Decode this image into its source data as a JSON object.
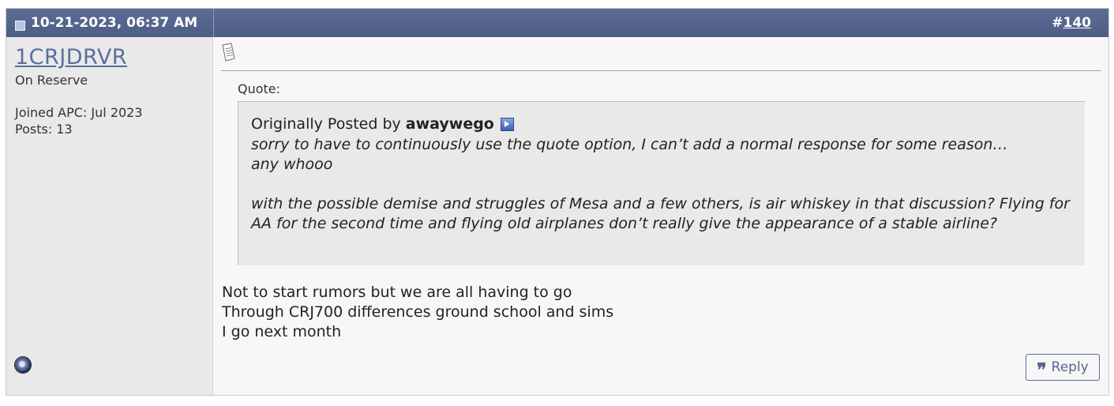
{
  "post": {
    "date": "10-21-2023, 06:37 AM",
    "number_prefix": "#",
    "number": "140"
  },
  "user": {
    "username": "1CRJDRVR",
    "title": "On Reserve",
    "joined": "Joined APC: Jul 2023",
    "posts": "Posts: 13",
    "status": "offline"
  },
  "quote": {
    "label": "Quote:",
    "originally_posted_by": "Originally Posted by",
    "author": "awaywego",
    "lines": [
      "sorry to have to continuously use the quote option, I can’t add a normal response for some reason…",
      "any whooo",
      "",
      "with the possible demise and struggles of Mesa and a few others, is air whiskey in that discussion? Flying for AA for the second time and flying old airplanes don’t really give the appearance of a stable airline?"
    ]
  },
  "message": {
    "lines": [
      "Not to start rumors but we are all having to go",
      "Through CRJ700 differences ground school and sims",
      "I go next month"
    ]
  },
  "actions": {
    "reply_label": "Reply"
  },
  "icons": {
    "header": "document-icon",
    "post": "post-icon",
    "view_post": "view-post-icon",
    "status": "status-icon",
    "reply": "quote-icon"
  },
  "colors": {
    "header_bg": "#56668e",
    "username": "#5a6f9b",
    "user_panel_bg": "#e9e9e9",
    "body_bg": "#f7f7f7",
    "quote_bg": "#e9e9e9"
  }
}
